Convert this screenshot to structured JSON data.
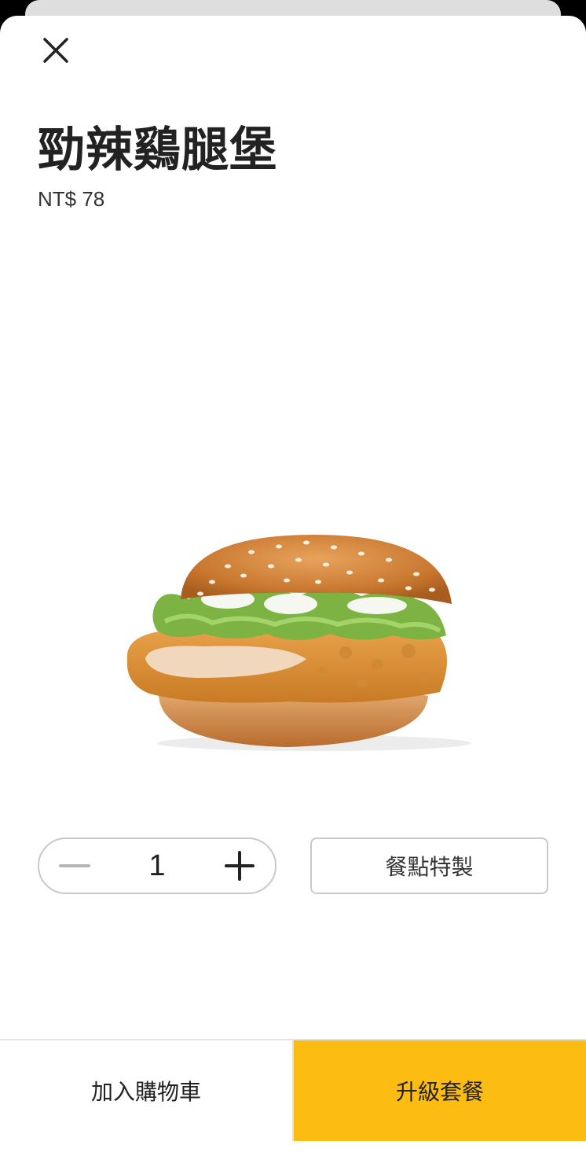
{
  "product": {
    "name": "勁辣鷄腿堡",
    "price": "NT$ 78",
    "image": "spicy-chicken-burger"
  },
  "quantity": {
    "value": "1",
    "decrement_icon": "minus-icon",
    "increment_icon": "plus-icon"
  },
  "actions": {
    "customize_label": "餐點特製",
    "add_to_cart_label": "加入購物車",
    "upgrade_meal_label": "升級套餐"
  },
  "colors": {
    "accent": "#fcbc11",
    "text": "#222222",
    "border": "#c9c9c9"
  }
}
